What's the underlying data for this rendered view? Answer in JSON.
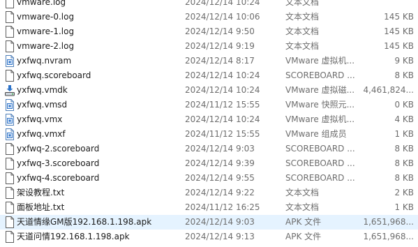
{
  "files": [
    {
      "name": "vmware.log",
      "date": "2024/12/14 10:24",
      "type": "文本文档",
      "size": "",
      "icon": "text-file-icon"
    },
    {
      "name": "vmware-0.log",
      "date": "2024/12/14 10:06",
      "type": "文本文档",
      "size": "145 KB",
      "icon": "text-file-icon"
    },
    {
      "name": "vmware-1.log",
      "date": "2024/12/14 9:50",
      "type": "文本文档",
      "size": "145 KB",
      "icon": "text-file-icon"
    },
    {
      "name": "vmware-2.log",
      "date": "2024/12/14 9:19",
      "type": "文本文档",
      "size": "145 KB",
      "icon": "text-file-icon"
    },
    {
      "name": "yxfwq.nvram",
      "date": "2024/12/14 8:17",
      "type": "VMware 虚拟机...",
      "size": "9 KB",
      "icon": "vmware-file-icon"
    },
    {
      "name": "yxfwq.scoreboard",
      "date": "2024/12/14 10:24",
      "type": "SCOREBOARD ...",
      "size": "8 KB",
      "icon": "blank-file-icon"
    },
    {
      "name": "yxfwq.vmdk",
      "date": "2024/12/14 10:24",
      "type": "VMware 虚拟磁...",
      "size": "4,461,824...",
      "icon": "vmdk-disk-icon"
    },
    {
      "name": "yxfwq.vmsd",
      "date": "2024/11/12 15:55",
      "type": "VMware 快照元...",
      "size": "0 KB",
      "icon": "vmware-file-icon"
    },
    {
      "name": "yxfwq.vmx",
      "date": "2024/12/14 10:24",
      "type": "VMware 虚拟机...",
      "size": "4 KB",
      "icon": "vmware-file-icon"
    },
    {
      "name": "yxfwq.vmxf",
      "date": "2024/11/12 15:55",
      "type": "VMware 组成员",
      "size": "1 KB",
      "icon": "vmware-file-icon"
    },
    {
      "name": "yxfwq-2.scoreboard",
      "date": "2024/12/14 9:03",
      "type": "SCOREBOARD ...",
      "size": "8 KB",
      "icon": "blank-file-icon"
    },
    {
      "name": "yxfwq-3.scoreboard",
      "date": "2024/12/14 9:39",
      "type": "SCOREBOARD ...",
      "size": "8 KB",
      "icon": "blank-file-icon"
    },
    {
      "name": "yxfwq-4.scoreboard",
      "date": "2024/12/14 9:55",
      "type": "SCOREBOARD ...",
      "size": "8 KB",
      "icon": "blank-file-icon"
    },
    {
      "name": "架设教程.txt",
      "date": "2024/12/14 9:22",
      "type": "文本文档",
      "size": "2 KB",
      "icon": "text-file-icon"
    },
    {
      "name": "面板地址.txt",
      "date": "2024/11/12 16:25",
      "type": "文本文档",
      "size": "1 KB",
      "icon": "text-file-icon"
    },
    {
      "name": "天道情缘GM版192.168.1.198.apk",
      "date": "2024/12/14 9:03",
      "type": "APK 文件",
      "size": "1,651,968...",
      "icon": "apk-file-icon"
    },
    {
      "name": "天道问情192.168.1.198.apk",
      "date": "2024/12/14 9:13",
      "type": "APK 文件",
      "size": "1,651,968...",
      "icon": "apk-file-icon"
    }
  ],
  "colors": {
    "selected_row": "#cce8ff",
    "hover_row": "#e5f3ff",
    "secondary_text": "#6d6d6d"
  }
}
